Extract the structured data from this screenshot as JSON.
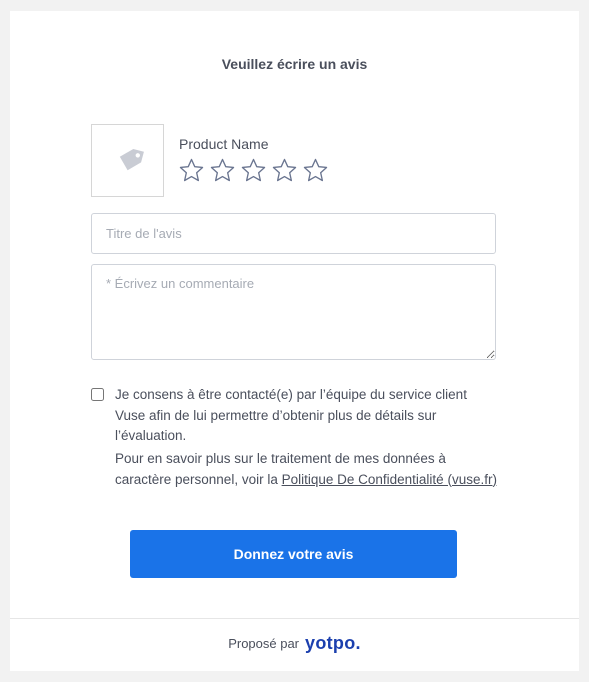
{
  "form": {
    "heading": "Veuillez écrire un avis",
    "product": {
      "name": "Product Name",
      "thumbnail_icon": "tag-icon",
      "rating": {
        "max": 5,
        "value": 0,
        "star_icon": "star-outline-icon",
        "star_color": "#6a7590"
      }
    },
    "title_field": {
      "value": "",
      "placeholder": "Titre de l'avis"
    },
    "comment_field": {
      "value": "",
      "placeholder": "* Écrivez un commentaire"
    },
    "consent": {
      "checked": false,
      "text": "Je consens à être contacté(e) par l’équipe du service client Vuse afin de lui permettre d’obtenir plus de détails sur l’évaluation."
    },
    "privacy": {
      "text_before": "Pour en savoir plus sur le traitement de mes données à caractère personnel, voir la ",
      "link_text": "Politique De Confidentialité (vuse.fr)"
    },
    "submit_label": "Donnez votre avis"
  },
  "footer": {
    "powered_by": "Proposé par",
    "brand": "yotpo."
  },
  "colors": {
    "accent": "#1a73e8",
    "brand": "#1b3fae",
    "text": "#4a4f5c",
    "border": "#cfd3da"
  }
}
